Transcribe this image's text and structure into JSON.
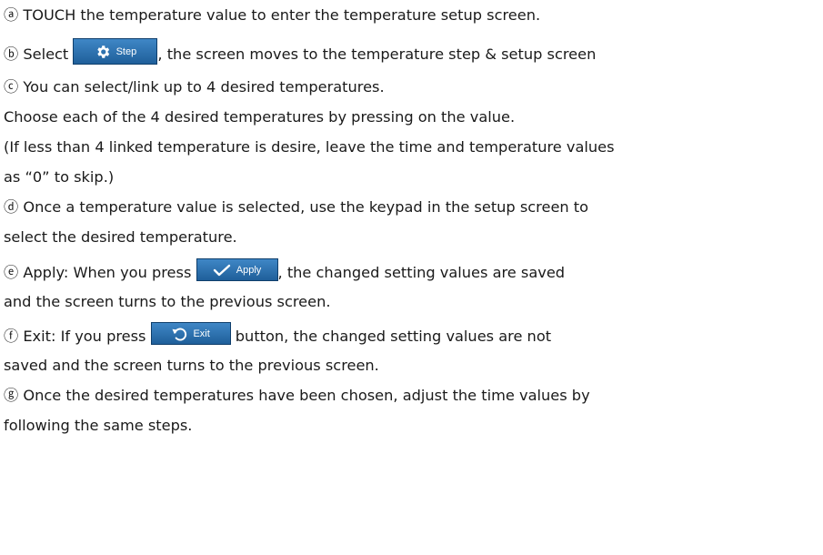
{
  "lines": {
    "a": "ⓐ TOUCH the temperature value to enter the temperature setup screen.",
    "b_pre": "ⓑ Select ",
    "b_post": ", the screen moves to the temperature step & setup screen",
    "c": "ⓒ You can select/link up to 4 desired temperatures.",
    "c2": "Choose each of the 4 desired temperatures by pressing on the value.",
    "c3": "(If less than 4 linked temperature is desire, leave the time and temperature values",
    "c4": "as “0” to skip.)",
    "d": "ⓓ Once a temperature value is selected, use the keypad in the setup screen to",
    "d2": "select the desired temperature.",
    "e_pre": "ⓔ Apply: When you press ",
    "e_post": ", the changed setting values are saved",
    "e2": "and the screen turns to the previous screen.",
    "f_pre": "ⓕ Exit: If you press ",
    "f_post": " button, the changed setting values are not",
    "f2": "saved and the screen turns to the previous screen.",
    "g": "ⓖ Once the desired temperatures have been chosen, adjust the time values by",
    "g2": "following the same steps."
  },
  "buttons": {
    "step": {
      "label": "Step",
      "icon": "gear-icon"
    },
    "apply": {
      "label": "Apply",
      "icon": "checkmark-icon"
    },
    "exit": {
      "label": "Exit",
      "icon": "undo-arrow-icon"
    }
  },
  "colors": {
    "button_bg": "#2a6fb0",
    "text": "#1a1a1a"
  }
}
